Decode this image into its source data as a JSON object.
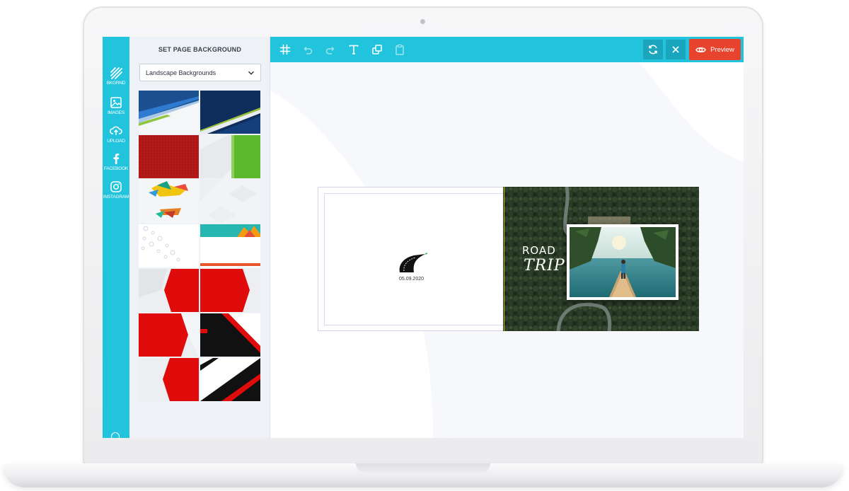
{
  "rail": {
    "items": [
      {
        "label": "BKGRND",
        "icon": "stripes-icon"
      },
      {
        "label": "IMAGES",
        "icon": "image-icon"
      },
      {
        "label": "UPLOAD",
        "icon": "upload-icon"
      },
      {
        "label": "FACEBOOK",
        "icon": "facebook-icon"
      },
      {
        "label": "INSTAGRAM",
        "icon": "instagram-icon"
      }
    ]
  },
  "panel": {
    "title": "SET PAGE BACKGROUND",
    "select_value": "Landscape Backgrounds"
  },
  "toolbar": {
    "tools": [
      "grid-icon",
      "undo-icon",
      "redo-icon",
      "text-icon",
      "shapes-icon",
      "clipboard-icon"
    ],
    "preview_label": "Preview"
  },
  "book": {
    "date": "05.09.2020",
    "title_line1": "ROAD",
    "title_line2": "TRIP"
  },
  "colors": {
    "accent": "#22c3dc",
    "accent_dark": "#1ba6bd",
    "preview": "#e8432c",
    "panel_bg": "#eef1f5"
  }
}
